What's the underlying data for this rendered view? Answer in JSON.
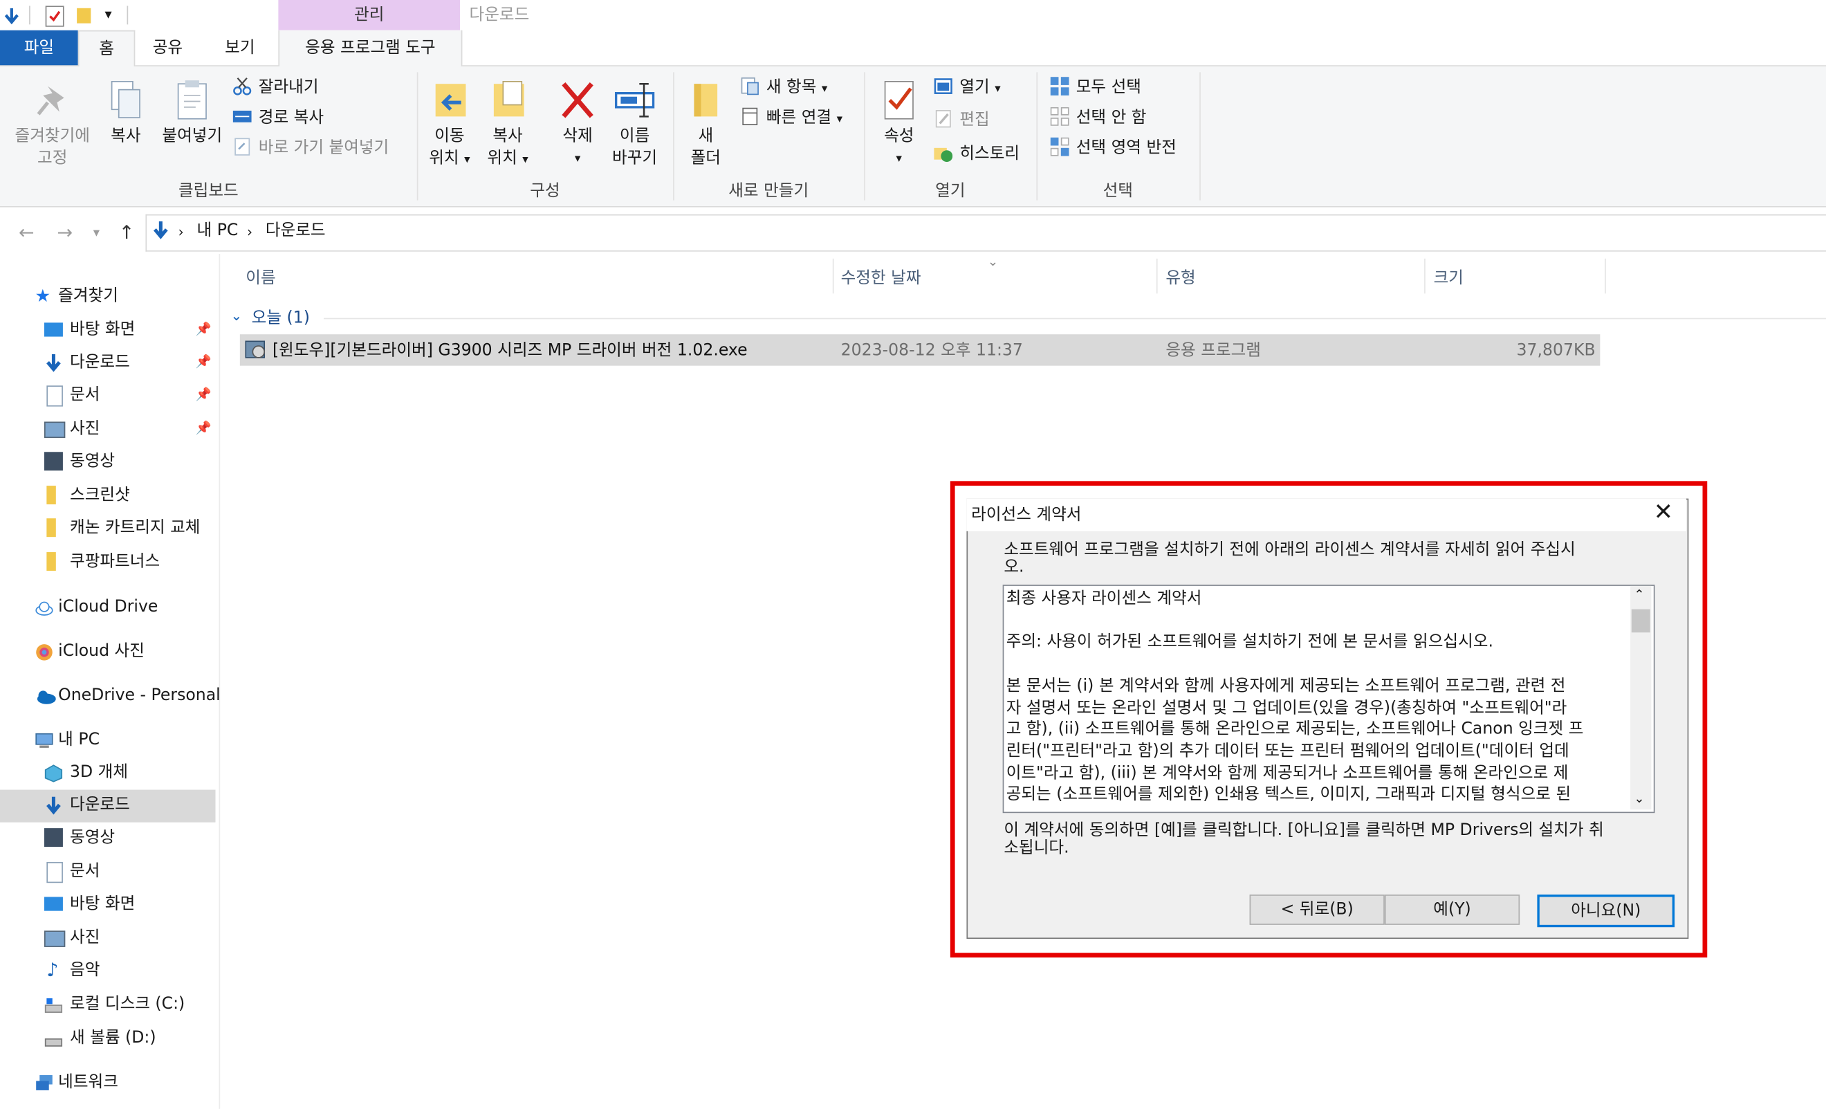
{
  "qat": {
    "context_tab_group": "관리",
    "window_title": "다운로드"
  },
  "tabs": {
    "file": "파일",
    "home": "홈",
    "share": "공유",
    "view": "보기",
    "app_tools": "응용 프로그램 도구"
  },
  "ribbon": {
    "clipboard": {
      "label": "클립보드",
      "pin_line1": "즐겨찾기에",
      "pin_line2": "고정",
      "copy": "복사",
      "paste": "붙여넣기",
      "cut": "잘라내기",
      "copy_path": "경로 복사",
      "paste_shortcut": "바로 가기 붙여넣기"
    },
    "organize": {
      "label": "구성",
      "move_line1": "이동",
      "move_line2": "위치",
      "copyto_line1": "복사",
      "copyto_line2": "위치",
      "delete": "삭제",
      "rename_line1": "이름",
      "rename_line2": "바꾸기"
    },
    "new": {
      "label": "새로 만들기",
      "folder_line1": "새",
      "folder_line2": "폴더",
      "new_item": "새 항목",
      "easy_access": "빠른 연결"
    },
    "open": {
      "label": "열기",
      "properties": "속성",
      "open": "열기",
      "edit": "편집",
      "history": "히스토리"
    },
    "select": {
      "label": "선택",
      "select_all": "모두 선택",
      "select_none": "선택 안 함",
      "invert": "선택 영역 반전"
    }
  },
  "address": {
    "root": "내 PC",
    "current": "다운로드"
  },
  "nav": {
    "quick_access": "즐겨찾기",
    "qa_items": [
      "바탕 화면",
      "다운로드",
      "문서",
      "사진",
      "동영상",
      "스크린샷",
      "캐논 카트리지 교체",
      "쿠팡파트너스"
    ],
    "icloud_drive": "iCloud Drive",
    "icloud_photos": "iCloud 사진",
    "onedrive": "OneDrive - Personal",
    "this_pc": "내 PC",
    "pc_items": [
      "3D 개체",
      "다운로드",
      "동영상",
      "문서",
      "바탕 화면",
      "사진",
      "음악",
      "로컬 디스크 (C:)",
      "새 볼륨 (D:)"
    ],
    "network": "네트워크"
  },
  "files": {
    "columns": {
      "name": "이름",
      "date": "수정한 날짜",
      "type": "유형",
      "size": "크기"
    },
    "group": "오늘 (1)",
    "rows": [
      {
        "name": "[윈도우][기본드라이버] G3900 시리즈 MP 드라이버 버전 1.02.exe",
        "date": "2023-08-12 오후 11:37",
        "type": "응용 프로그램",
        "size": "37,807KB"
      }
    ]
  },
  "dialog": {
    "title": "라이선스 계약서",
    "intro": "소프트웨어 프로그램을 설치하기 전에 아래의 라이센스 계약서를 자세히 읽어 주십시\n오.",
    "license_text": "최종 사용자 라이센스 계약서\n\n주의: 사용이 허가된 소프트웨어를 설치하기 전에 본 문서를 읽으십시오.\n\n본 문서는 (i) 본 계약서와 함께 사용자에게 제공되는 소프트웨어 프로그램, 관련 전\n자 설명서 또는 온라인 설명서 및 그 업데이트(있을 경우)(총칭하여 \"소프트웨어\"라\n고 함), (ii) 소프트웨어를 통해 온라인으로 제공되는, 소프트웨어나 Canon 잉크젯 프\n린터(\"프린터\"라고 함)의 추가 데이터 또는 프린터 펌웨어의 업데이트(\"데이터 업데\n이트\"라고 함), (iii) 본 계약서와 함께 제공되거나 소프트웨어를 통해 온라인으로 제\n공되는 (소프트웨어를 제외한) 인쇄용 텍스트, 이미지, 그래픽과 디지털 형식으로 된",
    "footer": "이 계약서에 동의하면 [예]를 클릭합니다. [아니요]를 클릭하면 MP Drivers의 설치가 취\n소됩니다.",
    "back": "< 뒤로(B)",
    "yes": "예(Y)",
    "no": "아니요(N)"
  }
}
